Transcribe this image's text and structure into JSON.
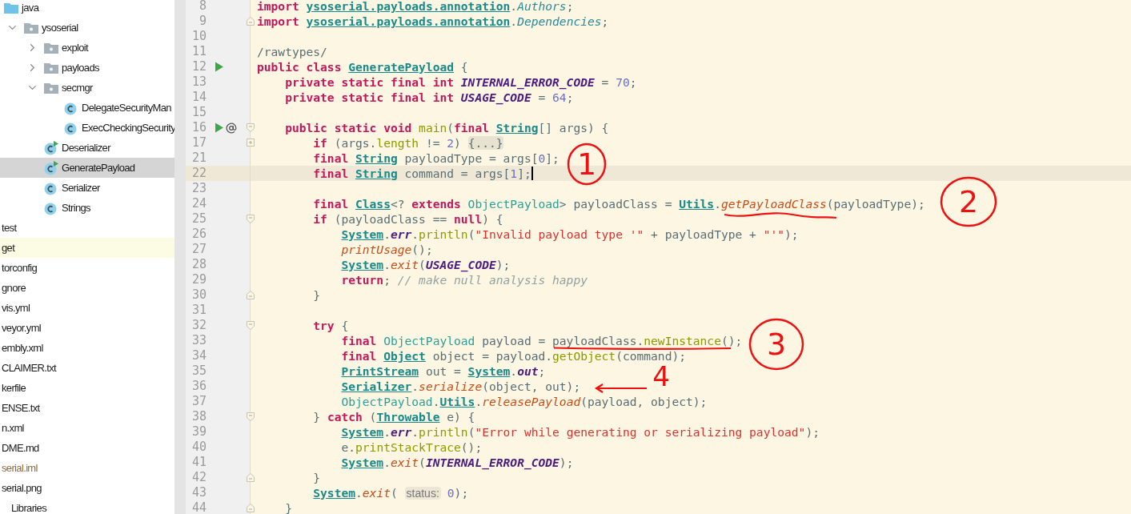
{
  "tree": [
    {
      "label": "java",
      "kind": "source-folder",
      "selected": false,
      "children": [
        {
          "label": "ysoserial",
          "kind": "package",
          "expanded": true,
          "selected": false,
          "children": [
            {
              "label": "exploit",
              "kind": "package",
              "expanded": false,
              "selected": false
            },
            {
              "label": "payloads",
              "kind": "package",
              "expanded": false,
              "selected": false
            },
            {
              "label": "secmgr",
              "kind": "package",
              "expanded": true,
              "selected": false,
              "children": [
                {
                  "label": "DelegateSecurityMan",
                  "kind": "class",
                  "selected": false
                },
                {
                  "label": "ExecCheckingSecurity",
                  "kind": "class",
                  "selected": false
                }
              ]
            },
            {
              "label": "Deserializer",
              "kind": "main-class",
              "selected": false
            },
            {
              "label": "GeneratePayload",
              "kind": "main-class",
              "selected": true
            },
            {
              "label": "Serializer",
              "kind": "class",
              "selected": false
            },
            {
              "label": "Strings",
              "kind": "class",
              "selected": false
            }
          ]
        }
      ]
    },
    {
      "label": "test",
      "kind": "file",
      "selected": false
    },
    {
      "label": "get",
      "kind": "excluded",
      "selected": false
    },
    {
      "label": "torconfig",
      "kind": "file",
      "selected": false
    },
    {
      "label": "gnore",
      "kind": "file",
      "selected": false
    },
    {
      "label": "vis.yml",
      "kind": "file",
      "selected": false
    },
    {
      "label": "veyor.yml",
      "kind": "file",
      "selected": false
    },
    {
      "label": "embly.xml",
      "kind": "file",
      "selected": false
    },
    {
      "label": "CLAIMER.txt",
      "kind": "file",
      "selected": false
    },
    {
      "label": "kerfile",
      "kind": "file",
      "selected": false
    },
    {
      "label": "ENSE.txt",
      "kind": "file",
      "selected": false
    },
    {
      "label": "n.xml",
      "kind": "file",
      "selected": false
    },
    {
      "label": "DME.md",
      "kind": "file",
      "selected": false
    },
    {
      "label": "serial.iml",
      "kind": "module-file",
      "selected": false
    },
    {
      "label": "serial.png",
      "kind": "file",
      "selected": false
    },
    {
      "label": "Libraries",
      "kind": "libraries",
      "selected": false
    }
  ],
  "editor": {
    "lines": [
      {
        "number": "8",
        "tokens": [
          {
            "kind": "keyword",
            "text": "import "
          },
          {
            "kind": "class",
            "text": "ysoserial.payloads.annotation"
          },
          {
            "kind": "plain",
            "text": "."
          },
          {
            "kind": "annotation",
            "text": "Authors"
          },
          {
            "kind": "plain",
            "text": ";"
          }
        ]
      },
      {
        "number": "9",
        "fold": {
          "kind": "end"
        },
        "tokens": [
          {
            "kind": "keyword",
            "text": "import "
          },
          {
            "kind": "class",
            "text": "ysoserial.payloads.annotation"
          },
          {
            "kind": "plain",
            "text": "."
          },
          {
            "kind": "annotation",
            "text": "Dependencies"
          },
          {
            "kind": "plain",
            "text": ";"
          }
        ]
      },
      {
        "number": "10"
      },
      {
        "number": "11",
        "tokens": [
          {
            "kind": "plain",
            "text": "/rawtypes/"
          }
        ]
      },
      {
        "number": "12",
        "gutter": [
          {
            "kind": "run"
          }
        ],
        "tokens": [
          {
            "kind": "keyword",
            "text": "public class "
          },
          {
            "kind": "class",
            "text": "GeneratePayload"
          },
          {
            "kind": "plain",
            "text": " {"
          }
        ]
      },
      {
        "number": "13",
        "tokens": [
          {
            "kind": "keyword",
            "text": "    private static final int "
          },
          {
            "kind": "constant",
            "text": "INTERNAL_ERROR_CODE"
          },
          {
            "kind": "plain",
            "text": " = "
          },
          {
            "kind": "number",
            "text": "70"
          },
          {
            "kind": "plain",
            "text": ";"
          }
        ]
      },
      {
        "number": "14",
        "tokens": [
          {
            "kind": "keyword",
            "text": "    private static final int "
          },
          {
            "kind": "constant",
            "text": "USAGE_CODE"
          },
          {
            "kind": "plain",
            "text": " = "
          },
          {
            "kind": "number",
            "text": "64"
          },
          {
            "kind": "plain",
            "text": ";"
          }
        ]
      },
      {
        "number": "15"
      },
      {
        "number": "16",
        "gutter": [
          {
            "kind": "run"
          },
          {
            "kind": "override"
          }
        ],
        "fold": {
          "kind": "start"
        },
        "tokens": [
          {
            "kind": "keyword",
            "text": "    public static void "
          },
          {
            "kind": "method",
            "text": "main"
          },
          {
            "kind": "plain",
            "text": "("
          },
          {
            "kind": "keyword",
            "text": "final "
          },
          {
            "kind": "class",
            "text": "String"
          },
          {
            "kind": "plain",
            "text": "[] args) {"
          }
        ]
      },
      {
        "number": "17",
        "fold": {
          "kind": "collapsed"
        },
        "tokens": [
          {
            "kind": "keyword",
            "text": "        if "
          },
          {
            "kind": "plain",
            "text": "(args."
          },
          {
            "kind": "method",
            "text": "length"
          },
          {
            "kind": "plain",
            "text": " != "
          },
          {
            "kind": "number",
            "text": "2"
          },
          {
            "kind": "plain",
            "text": ") "
          },
          {
            "kind": "folded",
            "text": "{...}"
          }
        ]
      },
      {
        "number": "21",
        "tokens": [
          {
            "kind": "keyword",
            "text": "        final "
          },
          {
            "kind": "class",
            "text": "String"
          },
          {
            "kind": "plain",
            "text": " payloadType = args["
          },
          {
            "kind": "number",
            "text": "0"
          },
          {
            "kind": "plain",
            "text": "];"
          }
        ]
      },
      {
        "number": "22",
        "current": true,
        "caret": true,
        "tokens": [
          {
            "kind": "keyword",
            "text": "        final "
          },
          {
            "kind": "class",
            "text": "String"
          },
          {
            "kind": "plain",
            "text": " command = args["
          },
          {
            "kind": "number",
            "text": "1"
          },
          {
            "kind": "plain",
            "text": "];"
          }
        ]
      },
      {
        "number": "23"
      },
      {
        "number": "24",
        "tokens": [
          {
            "kind": "keyword",
            "text": "        final "
          },
          {
            "kind": "class",
            "text": "Class"
          },
          {
            "kind": "plain",
            "text": "<? "
          },
          {
            "kind": "keyword",
            "text": "extends "
          },
          {
            "kind": "type",
            "text": "ObjectPayload"
          },
          {
            "kind": "plain",
            "text": "> payloadClass = "
          },
          {
            "kind": "class",
            "text": "Utils"
          },
          {
            "kind": "plain",
            "text": "."
          },
          {
            "kind": "static-method",
            "text": "getPayloadClass"
          },
          {
            "kind": "plain",
            "text": "(payloadType);"
          }
        ]
      },
      {
        "number": "25",
        "fold": {
          "kind": "start"
        },
        "tokens": [
          {
            "kind": "keyword",
            "text": "        if "
          },
          {
            "kind": "plain",
            "text": "(payloadClass == "
          },
          {
            "kind": "keyword",
            "text": "null"
          },
          {
            "kind": "plain",
            "text": ") {"
          }
        ]
      },
      {
        "number": "26",
        "tokens": [
          {
            "kind": "class",
            "text": "            System"
          },
          {
            "kind": "plain",
            "text": "."
          },
          {
            "kind": "constant",
            "text": "err"
          },
          {
            "kind": "plain",
            "text": "."
          },
          {
            "kind": "method",
            "text": "println"
          },
          {
            "kind": "plain",
            "text": "("
          },
          {
            "kind": "string",
            "text": "\"Invalid payload type '\""
          },
          {
            "kind": "plain",
            "text": " + payloadType + "
          },
          {
            "kind": "string",
            "text": "\"'\""
          },
          {
            "kind": "plain",
            "text": ");"
          }
        ]
      },
      {
        "number": "27",
        "tokens": [
          {
            "kind": "static-method",
            "text": "            printUsage"
          },
          {
            "kind": "plain",
            "text": "();"
          }
        ]
      },
      {
        "number": "28",
        "tokens": [
          {
            "kind": "class",
            "text": "            System"
          },
          {
            "kind": "plain",
            "text": "."
          },
          {
            "kind": "static-method",
            "text": "exit"
          },
          {
            "kind": "plain",
            "text": "("
          },
          {
            "kind": "constant",
            "text": "USAGE_CODE"
          },
          {
            "kind": "plain",
            "text": ");"
          }
        ]
      },
      {
        "number": "29",
        "tokens": [
          {
            "kind": "keyword",
            "text": "            return"
          },
          {
            "kind": "plain",
            "text": "; "
          },
          {
            "kind": "comment",
            "text": "// make null analysis happy"
          }
        ]
      },
      {
        "number": "30",
        "fold": {
          "kind": "end"
        },
        "tokens": [
          {
            "kind": "plain",
            "text": "        }"
          }
        ]
      },
      {
        "number": "31"
      },
      {
        "number": "32",
        "fold": {
          "kind": "start"
        },
        "tokens": [
          {
            "kind": "keyword",
            "text": "        try "
          },
          {
            "kind": "plain",
            "text": "{"
          }
        ]
      },
      {
        "number": "33",
        "tokens": [
          {
            "kind": "keyword",
            "text": "            final "
          },
          {
            "kind": "type",
            "text": "ObjectPayload"
          },
          {
            "kind": "plain",
            "text": " payload = payloadClass."
          },
          {
            "kind": "method",
            "text": "newInstance"
          },
          {
            "kind": "plain",
            "text": "();"
          }
        ]
      },
      {
        "number": "34",
        "tokens": [
          {
            "kind": "keyword",
            "text": "            final "
          },
          {
            "kind": "class",
            "text": "Object"
          },
          {
            "kind": "plain",
            "text": " object = payload."
          },
          {
            "kind": "method",
            "text": "getObject"
          },
          {
            "kind": "plain",
            "text": "(command);"
          }
        ]
      },
      {
        "number": "35",
        "tokens": [
          {
            "kind": "class",
            "text": "            PrintStream"
          },
          {
            "kind": "plain",
            "text": " out = "
          },
          {
            "kind": "class",
            "text": "System"
          },
          {
            "kind": "plain",
            "text": "."
          },
          {
            "kind": "constant",
            "text": "out"
          },
          {
            "kind": "plain",
            "text": ";"
          }
        ]
      },
      {
        "number": "36",
        "tokens": [
          {
            "kind": "class",
            "text": "            Serializer."
          },
          {
            "kind": "static-method",
            "text": "serialize"
          },
          {
            "kind": "plain",
            "text": "(object, out);"
          }
        ]
      },
      {
        "number": "37",
        "tokens": [
          {
            "kind": "type",
            "text": "            ObjectPayload."
          },
          {
            "kind": "class",
            "text": "Utils."
          },
          {
            "kind": "static-method",
            "text": "releasePayload"
          },
          {
            "kind": "plain",
            "text": "(payload, object);"
          }
        ]
      },
      {
        "number": "38",
        "fold": {
          "kind": "start"
        },
        "tokens": [
          {
            "kind": "plain",
            "text": "        } "
          },
          {
            "kind": "keyword",
            "text": "catch "
          },
          {
            "kind": "plain",
            "text": "("
          },
          {
            "kind": "class",
            "text": "Throwable"
          },
          {
            "kind": "plain",
            "text": " e) {"
          }
        ]
      },
      {
        "number": "39",
        "tokens": [
          {
            "kind": "class",
            "text": "            System"
          },
          {
            "kind": "plain",
            "text": "."
          },
          {
            "kind": "constant",
            "text": "err"
          },
          {
            "kind": "plain",
            "text": "."
          },
          {
            "kind": "method",
            "text": "println"
          },
          {
            "kind": "plain",
            "text": "("
          },
          {
            "kind": "string",
            "text": "\"Error while generating or serializing payload\""
          },
          {
            "kind": "plain",
            "text": ");"
          }
        ]
      },
      {
        "number": "40",
        "tokens": [
          {
            "kind": "plain",
            "text": "            e."
          },
          {
            "kind": "method",
            "text": "printStackTrace"
          },
          {
            "kind": "plain",
            "text": "();"
          }
        ]
      },
      {
        "number": "41",
        "tokens": [
          {
            "kind": "class",
            "text": "            System"
          },
          {
            "kind": "plain",
            "text": "."
          },
          {
            "kind": "static-method",
            "text": "exit"
          },
          {
            "kind": "plain",
            "text": "("
          },
          {
            "kind": "constant",
            "text": "INTERNAL_ERROR_CODE"
          },
          {
            "kind": "plain",
            "text": ");"
          }
        ]
      },
      {
        "number": "42",
        "fold": {
          "kind": "end"
        },
        "tokens": [
          {
            "kind": "plain",
            "text": "        }"
          }
        ]
      },
      {
        "number": "43",
        "tokens": [
          {
            "kind": "class",
            "text": "        System"
          },
          {
            "kind": "plain",
            "text": "."
          },
          {
            "kind": "static-method",
            "text": "exit"
          },
          {
            "kind": "plain",
            "text": "( "
          },
          {
            "kind": "hint",
            "text": "status:"
          },
          {
            "kind": "number",
            "text": "0"
          },
          {
            "kind": "plain",
            "text": ");"
          }
        ]
      },
      {
        "number": "44",
        "fold": {
          "kind": "end"
        },
        "tokens": [
          {
            "kind": "plain",
            "text": "    }"
          }
        ]
      }
    ]
  },
  "annotations": [
    {
      "kind": "circle",
      "label": "1",
      "underline": false
    },
    {
      "kind": "circle",
      "label": "2",
      "underline": true
    },
    {
      "kind": "circle",
      "label": "3",
      "underline": true
    },
    {
      "kind": "arrow",
      "label": "4",
      "underline": false
    }
  ]
}
